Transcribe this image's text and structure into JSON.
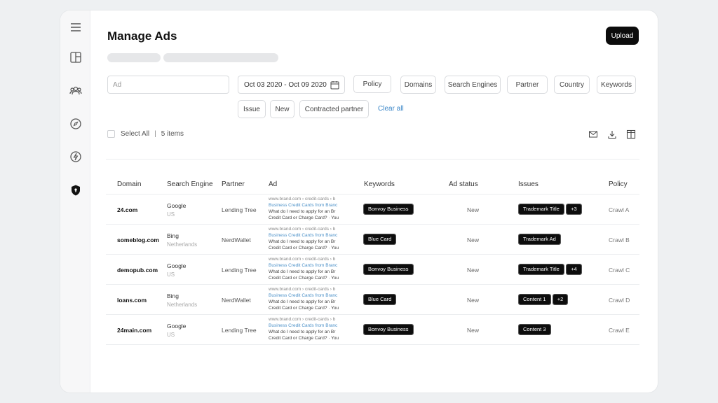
{
  "page": {
    "title": "Manage Ads",
    "upload_label": "Upload"
  },
  "sidebar": {
    "icons": [
      "menu-icon",
      "dashboard-icon",
      "users-icon",
      "compass-icon",
      "lightning-icon",
      "shield-icon"
    ]
  },
  "filters": {
    "ad_placeholder": "Ad",
    "date_range": "Oct 03 2020 - Oct 09 2020",
    "buttons": [
      "Policy",
      "Domains",
      "Search Engines",
      "Partner",
      "Country",
      "Keywords",
      "Issue",
      "New",
      "Contracted partner"
    ],
    "clear_all": "Clear all"
  },
  "selection": {
    "select_all": "Select All",
    "items_count": "5 items"
  },
  "table": {
    "headers": [
      "Domain",
      "Search Engine",
      "Partner",
      "Ad",
      "Keywords",
      "Ad status",
      "Issues",
      "Policy"
    ],
    "rows": [
      {
        "domain": "24.com",
        "engine": "Google",
        "region": "US",
        "partner": "Lending Tree",
        "ad_url": "www.brand.com › credit-cards › b",
        "ad_link": "Business Credit Cards from Branc",
        "ad_line1": "What do I need to apply for an Br",
        "ad_line2": "Credit Card or Charge Card? · You",
        "keyword": "Bonvoy Business",
        "status": "New",
        "issue1": "Trademark Title",
        "issue2": "+3",
        "policy": "Crawl A"
      },
      {
        "domain": "someblog.com",
        "engine": "Bing",
        "region": "Netherlands",
        "partner": "NerdWallet",
        "ad_url": "www.brand.com › credit-cards › b",
        "ad_link": "Business Credit Cards from Branc",
        "ad_line1": "What do I need to apply for an Br",
        "ad_line2": "Credit Card or Charge Card? · You",
        "keyword": "Blue Card",
        "status": "New",
        "issue1": "Trademark Ad",
        "issue2": "",
        "policy": "Crawl B"
      },
      {
        "domain": "demopub.com",
        "engine": "Google",
        "region": "US",
        "partner": "Lending Tree",
        "ad_url": "www.brand.com › credit-cards › b",
        "ad_link": "Business Credit Cards from Branc",
        "ad_line1": "What do I need to apply for an Br",
        "ad_line2": "Credit Card or Charge Card? · You",
        "keyword": "Bonvoy Business",
        "status": "New",
        "issue1": "Trademark Title",
        "issue2": "+4",
        "policy": "Crawl C"
      },
      {
        "domain": "loans.com",
        "engine": "Bing",
        "region": "Netherlands",
        "partner": "NerdWallet",
        "ad_url": "www.brand.com › credit-cards › b",
        "ad_link": "Business Credit Cards from Branc",
        "ad_line1": "What do I need to apply for an Br",
        "ad_line2": "Credit Card or Charge Card? · You",
        "keyword": "Blue Card",
        "status": "New",
        "issue1": "Content 1",
        "issue2": "+2",
        "policy": "Crawl D"
      },
      {
        "domain": "24main.com",
        "engine": "Google",
        "region": "US",
        "partner": "Lending Tree",
        "ad_url": "www.brand.com › credit-cards › b",
        "ad_link": "Business Credit Cards from Branc",
        "ad_line1": "What do I need to apply for an Br",
        "ad_line2": "Credit Card or Charge Card? · You",
        "keyword": "Bonvoy Business",
        "status": "New",
        "issue1": "Content 3",
        "issue2": "",
        "policy": "Crawl E"
      }
    ]
  }
}
